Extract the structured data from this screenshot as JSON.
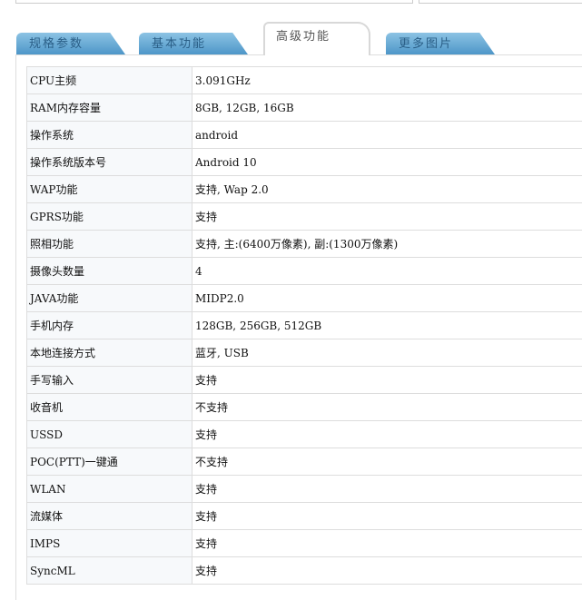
{
  "tabs": [
    "规格参数",
    "基本功能",
    "高级功能",
    "更多图片"
  ],
  "active_tab": 2,
  "rows": [
    [
      "CPU主频",
      "3.091GHz"
    ],
    [
      "RAM内存容量",
      "8GB, 12GB, 16GB"
    ],
    [
      "操作系统",
      "android"
    ],
    [
      "操作系统版本号",
      "Android 10"
    ],
    [
      "WAP功能",
      "支持, Wap 2.0"
    ],
    [
      "GPRS功能",
      "支持"
    ],
    [
      "照相功能",
      "支持, 主:(6400万像素), 副:(1300万像素)"
    ],
    [
      "摄像头数量",
      "4"
    ],
    [
      "JAVA功能",
      "MIDP2.0"
    ],
    [
      "手机内存",
      "128GB, 256GB, 512GB"
    ],
    [
      "本地连接方式",
      "蓝牙, USB"
    ],
    [
      "手写输入",
      "支持"
    ],
    [
      "收音机",
      "不支持"
    ],
    [
      "USSD",
      "支持"
    ],
    [
      "POC(PTT)一键通",
      "不支持"
    ],
    [
      "WLAN",
      "支持"
    ],
    [
      "流媒体",
      "支持"
    ],
    [
      "IMPS",
      "支持"
    ],
    [
      "SyncML",
      "支持"
    ]
  ]
}
